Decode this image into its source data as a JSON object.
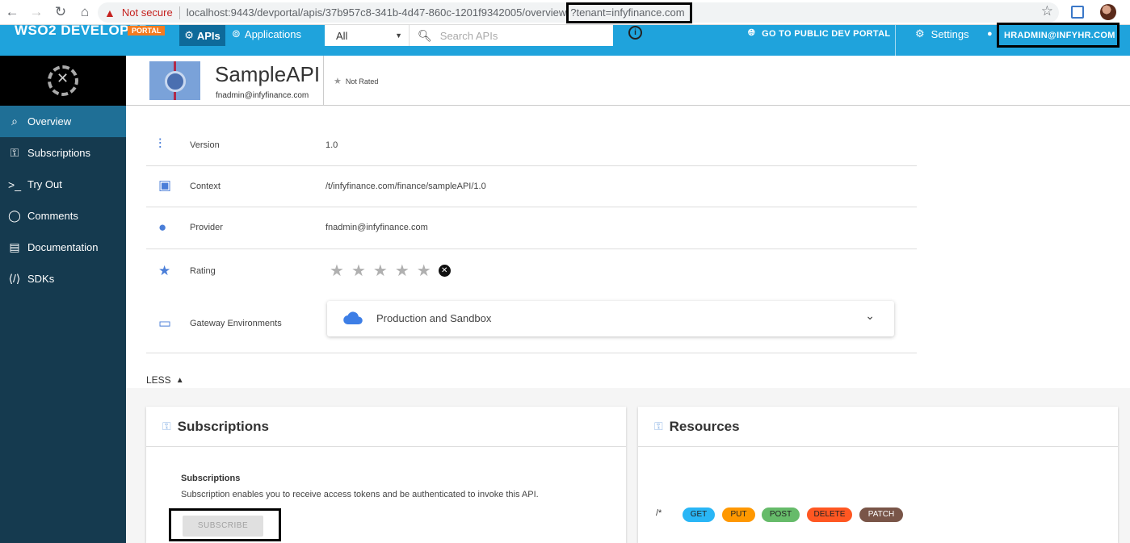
{
  "browser": {
    "security": "Not secure",
    "url": "localhost:9443/devportal/apis/37b957c8-341b-4d47-860c-1201f9342005/overview",
    "url_tail": "?tenant=infyfinance.com"
  },
  "header": {
    "logo": "WSO2 DEVELOPER",
    "logo_badge": "PORTAL",
    "tabs": [
      {
        "label": "APIs"
      },
      {
        "label": "Applications"
      }
    ],
    "search_scope": "All",
    "search_placeholder": "Search APIs",
    "public_portal": "GO TO PUBLIC DEV PORTAL",
    "settings": "Settings",
    "user": "HRADMIN@INFYHR.COM"
  },
  "sidebar": {
    "items": [
      {
        "label": "Overview"
      },
      {
        "label": "Subscriptions"
      },
      {
        "label": "Try Out"
      },
      {
        "label": "Comments"
      },
      {
        "label": "Documentation"
      },
      {
        "label": "SDKs"
      }
    ]
  },
  "api": {
    "name": "SampleAPI",
    "owner": "fnadmin@infyfinance.com",
    "rating_summary": "Not Rated"
  },
  "details": {
    "version_label": "Version",
    "version_value": "1.0",
    "context_label": "Context",
    "context_value": "/t/infyfinance.com/finance/sampleAPI/1.0",
    "provider_label": "Provider",
    "provider_value": "fnadmin@infyfinance.com",
    "rating_label": "Rating",
    "gateway_label": "Gateway Environments",
    "gateway_value": "Production and Sandbox"
  },
  "less_label": "LESS",
  "subscriptions_card": {
    "title": "Subscriptions",
    "subtitle": "Subscriptions",
    "description": "Subscription enables you to receive access tokens and be authenticated to invoke this API.",
    "button": "SUBSCRIBE"
  },
  "resources_card": {
    "title": "Resources",
    "path": "/*",
    "verbs": [
      {
        "label": "GET",
        "color": "#29b6f6"
      },
      {
        "label": "PUT",
        "color": "#ff9800"
      },
      {
        "label": "POST",
        "color": "#66bb6a"
      },
      {
        "label": "DELETE",
        "color": "#ff5722"
      },
      {
        "label": "PATCH",
        "color": "#795548"
      }
    ]
  }
}
